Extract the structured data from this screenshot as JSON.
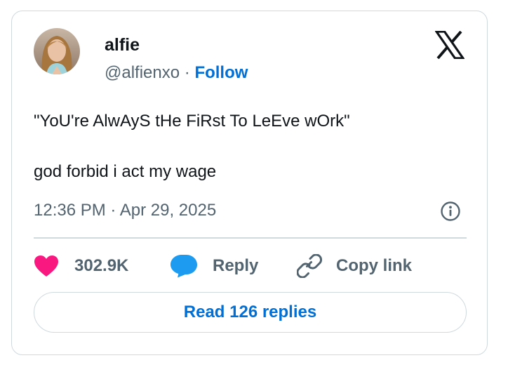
{
  "author": {
    "name": "alfie",
    "handle": "@alfienxo",
    "separator": "·",
    "follow_label": "Follow",
    "avatar_icon": "profile-photo"
  },
  "tweet": {
    "line1": "\"YoU're AlwAyS tHe FiRst To LeEve wOrk\"",
    "line2": "god forbid i act my wage"
  },
  "timestamp": "12:36 PM · Apr 29, 2025",
  "actions": {
    "like_count": "302.9K",
    "reply_label": "Reply",
    "copy_label": "Copy link"
  },
  "read_replies_label": "Read 126 replies",
  "colors": {
    "like": "#f91880",
    "reply": "#1d9bf0",
    "link": "#006fd6",
    "muted": "#536471",
    "border": "#cfd9de"
  },
  "icons": [
    "x-logo-icon",
    "info-icon",
    "heart-icon",
    "reply-bubble-icon",
    "link-icon"
  ]
}
